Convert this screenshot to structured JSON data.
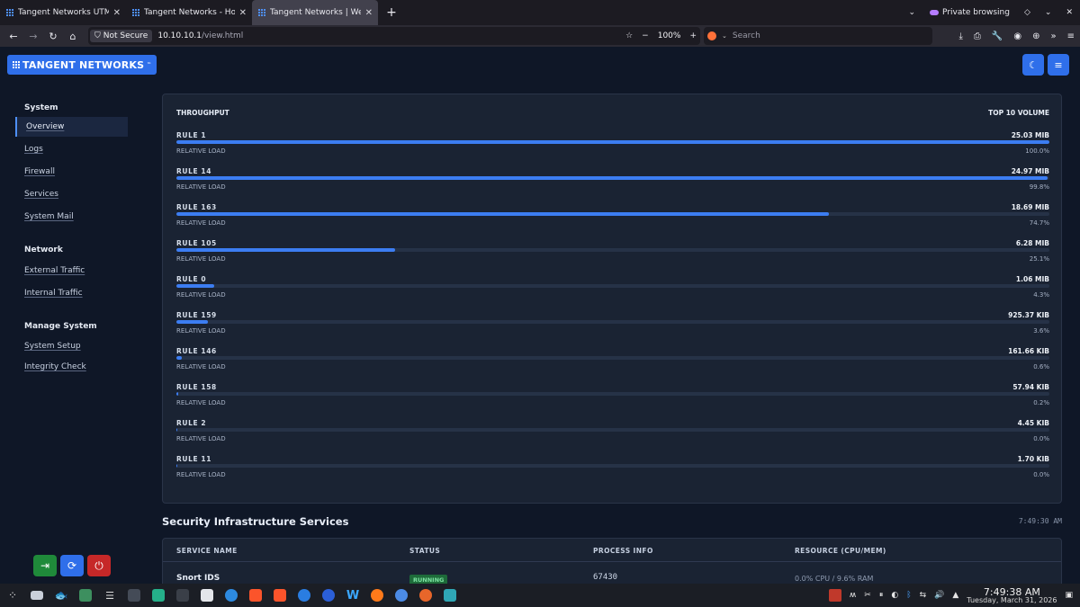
{
  "browser": {
    "tabs": [
      {
        "title": "Tangent Networks UTM — ",
        "active": false
      },
      {
        "title": "Tangent Networks - Home",
        "active": false
      },
      {
        "title": "Tangent Networks | Web i",
        "active": true
      }
    ],
    "private_label": "Private browsing",
    "security_label": "Not Secure",
    "url_host": "10.10.10.1",
    "url_path": "/view.html",
    "zoom": "100%",
    "search_placeholder": "Search"
  },
  "app": {
    "logo": "TANGENT NETWORKS",
    "logo_mark": "™",
    "accent": "#2f6fea"
  },
  "sidebar": {
    "sections": [
      {
        "title": "System",
        "items": [
          "Overview",
          "Logs",
          "Firewall",
          "Services",
          "System Mail"
        ]
      },
      {
        "title": "Network",
        "items": [
          "External Traffic",
          "Internal Traffic"
        ]
      },
      {
        "title": "Manage System",
        "items": [
          "System Setup",
          "Integrity Check"
        ]
      }
    ],
    "active_item": "Overview"
  },
  "throughput": {
    "title": "THROUGHPUT",
    "subtitle": "TOP 10 VOLUME",
    "load_label": "RELATIVE LOAD",
    "rules": [
      {
        "name": "RULE 1",
        "volume": "25.03 MIB",
        "load": "100.0%",
        "fraction": 1.0
      },
      {
        "name": "RULE 14",
        "volume": "24.97 MIB",
        "load": "99.8%",
        "fraction": 0.998
      },
      {
        "name": "RULE 163",
        "volume": "18.69 MIB",
        "load": "74.7%",
        "fraction": 0.747
      },
      {
        "name": "RULE 105",
        "volume": "6.28 MIB",
        "load": "25.1%",
        "fraction": 0.251
      },
      {
        "name": "RULE 0",
        "volume": "1.06 MIB",
        "load": "4.3%",
        "fraction": 0.043
      },
      {
        "name": "RULE 159",
        "volume": "925.37 KIB",
        "load": "3.6%",
        "fraction": 0.036
      },
      {
        "name": "RULE 146",
        "volume": "161.66 KIB",
        "load": "0.6%",
        "fraction": 0.006
      },
      {
        "name": "RULE 158",
        "volume": "57.94 KIB",
        "load": "0.2%",
        "fraction": 0.002
      },
      {
        "name": "RULE 2",
        "volume": "4.45 KIB",
        "load": "0.0%",
        "fraction": 0.0
      },
      {
        "name": "RULE 11",
        "volume": "1.70 KIB",
        "load": "0.0%",
        "fraction": 0.0
      }
    ]
  },
  "services": {
    "title": "Security Infrastructure Services",
    "time": "7:49:30 AM",
    "columns": [
      "SERVICE NAME",
      "STATUS",
      "PROCESS INFO",
      "RESOURCE (CPU/MEM)"
    ],
    "rows": [
      {
        "name": "Snort IDS",
        "status": "RUNNING",
        "process": "67430",
        "resource": "0.0% CPU / 9.6% RAM"
      }
    ]
  },
  "taskbar": {
    "time": "7:49:38 AM",
    "date": "Tuesday, March 31, 2026"
  }
}
